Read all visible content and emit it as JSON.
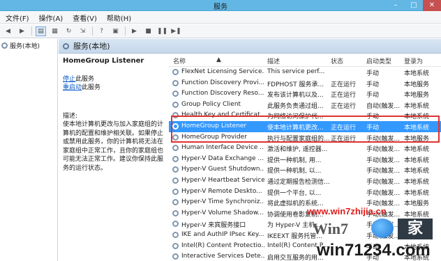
{
  "window": {
    "title": "服务",
    "controls": [
      "–",
      "□",
      "✕"
    ]
  },
  "menu": [
    "文件(F)",
    "操作(A)",
    "查看(V)",
    "帮助(H)"
  ],
  "toolbar_icons": [
    "back-icon",
    "forward-icon",
    "console-tree-icon",
    "properties-icon",
    "refresh-icon",
    "export-icon",
    "help-icon",
    "mmc-icon",
    "start-service-icon",
    "stop-service-icon",
    "pause-service-icon",
    "restart-service-icon"
  ],
  "tree": {
    "root": "服务(本地)"
  },
  "panel": {
    "title": "服务(本地)"
  },
  "details": {
    "service_name": "HomeGroup Listener",
    "stop_link": "停止",
    "stop_suffix": "此服务",
    "restart_link": "重启动",
    "restart_suffix": "此服务",
    "description_label": "描述:",
    "description": "使本地计算机更改与加入家庭组的计算机的配置和维护相关联。如果停止或禁用此服务，你的计算机将无法在家庭组中正常工作，且你的家庭组也可能无法正常工作。建议你保持此服务的运行状态。"
  },
  "columns": {
    "name": "名称",
    "desc": "描述",
    "state": "状态",
    "start": "启动类型",
    "logon": "登录为"
  },
  "services": [
    {
      "name": "FlexNet Licensing Service...",
      "desc": "This service perf...",
      "state": "",
      "start": "手动",
      "logon": "本地系统"
    },
    {
      "name": "Function Discovery Provi...",
      "desc": "FDPHOST 服务承...",
      "state": "正在运行",
      "start": "手动",
      "logon": "本地服务"
    },
    {
      "name": "Function Discovery Reso...",
      "desc": "发布该计算机以及...",
      "state": "正在运行",
      "start": "手动",
      "logon": "本地服务"
    },
    {
      "name": "Group Policy Client",
      "desc": "此服务负责通过组...",
      "state": "正在运行",
      "start": "自动(触发...",
      "logon": "本地系统"
    },
    {
      "name": "Health Key and Certificat...",
      "desc": "为网络访问保护代...",
      "state": "",
      "start": "手动",
      "logon": "本地系统"
    },
    {
      "name": "HomeGroup Listener",
      "desc": "使本地计算机更改...",
      "state": "正在运行",
      "start": "手动",
      "logon": "本地系统",
      "selected": true
    },
    {
      "name": "HomeGroup Provider",
      "desc": "执行与配置家庭组的...",
      "state": "正在运行",
      "start": "手动(触发...",
      "logon": "本地服务"
    },
    {
      "name": "Human Interface Device ...",
      "desc": "激活和维护, 遥控器...",
      "state": "",
      "start": "手动(触发...",
      "logon": "本地系统"
    },
    {
      "name": "Hyper-V Data Exchange ...",
      "desc": "提供一种机制, 用...",
      "state": "",
      "start": "手动(触发...",
      "logon": "本地系统"
    },
    {
      "name": "Hyper-V Guest Shutdown...",
      "desc": "提供一种机制, 以...",
      "state": "",
      "start": "手动(触发...",
      "logon": "本地系统"
    },
    {
      "name": "Hyper-V Heartbeat Service",
      "desc": "通过定期报告检测信...",
      "state": "",
      "start": "手动(触发...",
      "logon": "本地系统"
    },
    {
      "name": "Hyper-V Remote Deskto...",
      "desc": "提供一个平台, 以...",
      "state": "",
      "start": "手动(触发...",
      "logon": "本地系统"
    },
    {
      "name": "Hyper-V Time Synchroniz...",
      "desc": "将此虚拟机的系统...",
      "state": "",
      "start": "手动(触发...",
      "logon": "本地服务"
    },
    {
      "name": "Hyper-V Volume Shadow...",
      "desc": "协调使用卷影复制...",
      "state": "",
      "start": "手动(触发...",
      "logon": "本地系统"
    },
    {
      "name": "Hyper-V 来宾服务接口",
      "desc": "为 Hyper-V 主机...",
      "state": "",
      "start": "手动(触发...",
      "logon": "本地系统"
    },
    {
      "name": "IKE and AuthIP IPsec Key...",
      "desc": "IKEEXT 服务托管...",
      "state": "",
      "start": "手动(触发...",
      "logon": "本地系统"
    },
    {
      "name": "Intel(R) Content Protectio...",
      "desc": "Intel(R) Content P...",
      "state": "",
      "start": "手动",
      "logon": "本地系统"
    },
    {
      "name": "Interactive Services Dete...",
      "desc": "启用交互服务的用...",
      "state": "",
      "start": "手动",
      "logon": "本地系统"
    }
  ],
  "watermark": {
    "site": "www.win7zhijia.cn",
    "logo": "Win7",
    "logo_home": "家",
    "url": "win71234.com"
  }
}
